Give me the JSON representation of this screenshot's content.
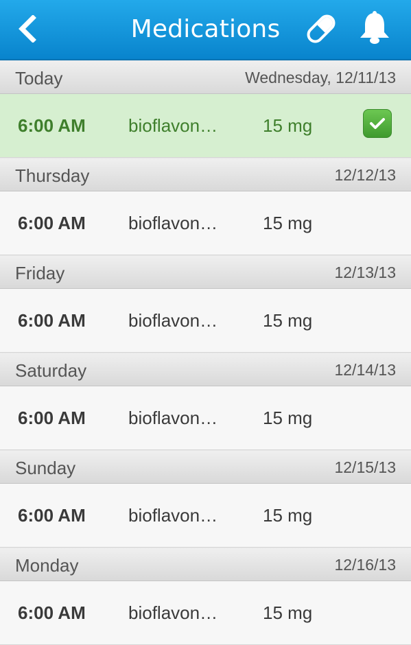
{
  "nav": {
    "title": "Medications",
    "color_top": "#23a9ea",
    "color_bottom": "#0883cc",
    "icons": [
      "chevron-left-icon",
      "pill-icon",
      "bell-icon"
    ]
  },
  "sections": [
    {
      "day": "Today",
      "date": "Wednesday, 12/11/13",
      "rows": [
        {
          "time": "6:00 AM",
          "name": "bioflavon…",
          "dose": "15 mg",
          "taken": true
        }
      ]
    },
    {
      "day": "Thursday",
      "date": "12/12/13",
      "rows": [
        {
          "time": "6:00 AM",
          "name": "bioflavon…",
          "dose": "15 mg",
          "taken": false
        }
      ]
    },
    {
      "day": "Friday",
      "date": "12/13/13",
      "rows": [
        {
          "time": "6:00 AM",
          "name": "bioflavon…",
          "dose": "15 mg",
          "taken": false
        }
      ]
    },
    {
      "day": "Saturday",
      "date": "12/14/13",
      "rows": [
        {
          "time": "6:00 AM",
          "name": "bioflavon…",
          "dose": "15 mg",
          "taken": false
        }
      ]
    },
    {
      "day": "Sunday",
      "date": "12/15/13",
      "rows": [
        {
          "time": "6:00 AM",
          "name": "bioflavon…",
          "dose": "15 mg",
          "taken": false
        }
      ]
    },
    {
      "day": "Monday",
      "date": "12/16/13",
      "rows": [
        {
          "time": "6:00 AM",
          "name": "bioflavon…",
          "dose": "15 mg",
          "taken": false
        }
      ]
    }
  ],
  "colors": {
    "taken_row": "#d6efd0",
    "taken_text": "#3f7f2c",
    "check_green": "#4faf38"
  }
}
